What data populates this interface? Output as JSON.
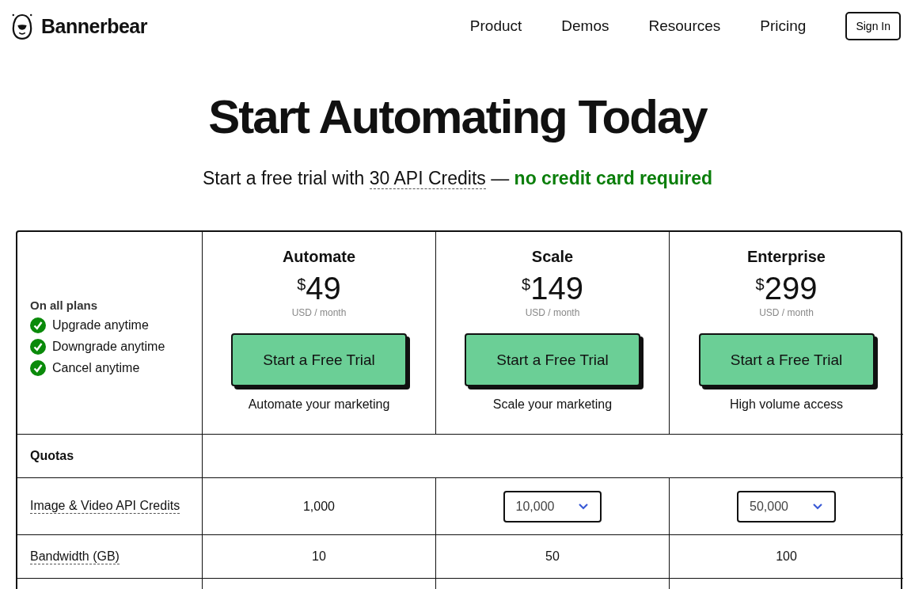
{
  "brand": "Bannerbear",
  "nav": [
    "Product",
    "Demos",
    "Resources",
    "Pricing"
  ],
  "sign_in": "Sign In",
  "headline": "Start Automating Today",
  "subtitle": {
    "lead": "Start a free trial with",
    "link": "30 API Credits",
    "dash": "—",
    "highlight": "no credit card required"
  },
  "features": {
    "title": "On all plans",
    "items": [
      "Upgrade anytime",
      "Downgrade anytime",
      "Cancel anytime"
    ]
  },
  "plans": [
    {
      "name": "Automate",
      "currency": "$",
      "price": "49",
      "period": "USD / month",
      "button": "Start a Free Trial",
      "tagline": "Automate your marketing"
    },
    {
      "name": "Scale",
      "currency": "$",
      "price": "149",
      "period": "USD / month",
      "button": "Start a Free Trial",
      "tagline": "Scale your marketing"
    },
    {
      "name": "Enterprise",
      "currency": "$",
      "price": "299",
      "period": "USD / month",
      "button": "Start a Free Trial",
      "tagline": "High volume access"
    }
  ],
  "section": "Quotas",
  "rows": [
    {
      "label": "Image & Video API Credits",
      "cells": [
        {
          "kind": "text",
          "value": "1,000"
        },
        {
          "kind": "select",
          "value": "10,000"
        },
        {
          "kind": "select",
          "value": "50,000"
        }
      ]
    },
    {
      "label": "Bandwidth (GB)",
      "cells": [
        {
          "kind": "text",
          "value": "10"
        },
        {
          "kind": "text",
          "value": "50"
        },
        {
          "kind": "text",
          "value": "100"
        }
      ]
    }
  ]
}
